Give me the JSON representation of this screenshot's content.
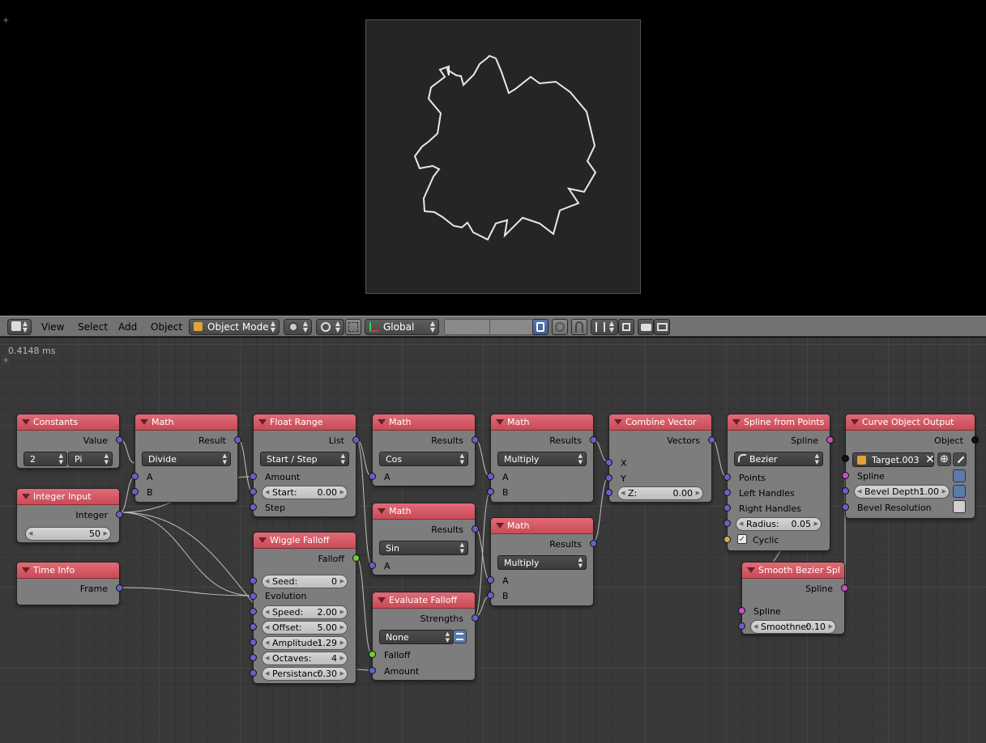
{
  "header": {
    "menus": [
      "View",
      "Select",
      "Add",
      "Object"
    ],
    "mode": "Object Mode",
    "orientation": "Global",
    "icons": [
      "editor-type-icon",
      "viewport-shading-icon",
      "pivot-icon",
      "manipulator-icon",
      "layers-icon",
      "lock-icon",
      "proportional-icon",
      "snap-icon",
      "render-icon",
      "opengl-render-icon"
    ]
  },
  "editor": {
    "timing": "0.4148 ms"
  },
  "nodes": {
    "constants": {
      "title": "Constants",
      "out": "Value",
      "count": "2",
      "const": "Pi"
    },
    "integer_input": {
      "title": "Integer Input",
      "out": "Integer",
      "value": "50"
    },
    "time_info": {
      "title": "Time Info",
      "out": "Frame"
    },
    "math_divide": {
      "title": "Math",
      "out": "Result",
      "op": "Divide",
      "a": "A",
      "b": "B"
    },
    "float_range": {
      "title": "Float Range",
      "out": "List",
      "mode": "Start / Step",
      "amount": "Amount",
      "start_label": "Start:",
      "start_value": "0.00",
      "step": "Step"
    },
    "wiggle": {
      "title": "Wiggle Falloff",
      "out": "Falloff",
      "seed_label": "Seed:",
      "seed": "0",
      "evolution": "Evolution",
      "speed_label": "Speed:",
      "speed": "2.00",
      "offset_label": "Offset:",
      "offset": "5.00",
      "amp_label": "Amplitude:",
      "amp": "1.29",
      "oct_label": "Octaves:",
      "oct": "4",
      "pers_label": "Persistanc:",
      "pers": "0.30"
    },
    "math_cos": {
      "title": "Math",
      "out": "Results",
      "op": "Cos",
      "a": "A"
    },
    "math_sin": {
      "title": "Math",
      "out": "Results",
      "op": "Sin",
      "a": "A"
    },
    "eval_falloff": {
      "title": "Evaluate Falloff",
      "out": "Strengths",
      "mode": "None",
      "falloff": "Falloff",
      "amount": "Amount"
    },
    "math_mul1": {
      "title": "Math",
      "out": "Results",
      "op": "Multiply",
      "a": "A",
      "b": "B"
    },
    "math_mul2": {
      "title": "Math",
      "out": "Results",
      "op": "Multiply",
      "a": "A",
      "b": "B"
    },
    "combine": {
      "title": "Combine Vector",
      "out": "Vectors",
      "x": "X",
      "y": "Y",
      "z_label": "Z:",
      "z": "0.00"
    },
    "spline_pts": {
      "title": "Spline from Points",
      "out": "Spline",
      "type": "Bezier",
      "points": "Points",
      "left": "Left Handles",
      "right": "Right Handles",
      "radius_label": "Radius:",
      "radius": "0.05",
      "cyclic": "Cyclic"
    },
    "smooth": {
      "title": "Smooth Bezier Spl",
      "out": "Spline",
      "spline": "Spline",
      "smooth_label": "Smoothne:",
      "smooth": "0.10"
    },
    "curve_out": {
      "title": "Curve Object Output",
      "out": "Object",
      "target": "Target.003",
      "spline": "Spline",
      "bevel_label": "Bevel Depth:",
      "bevel": "1.00",
      "bevel_res": "Bevel Resolution"
    }
  },
  "colors": {
    "node_header": "#d85a66",
    "node_body": "#7d7d7d",
    "socket_float": "#6363c7",
    "socket_falloff": "#6ed133",
    "socket_spline": "#c84fc8"
  }
}
